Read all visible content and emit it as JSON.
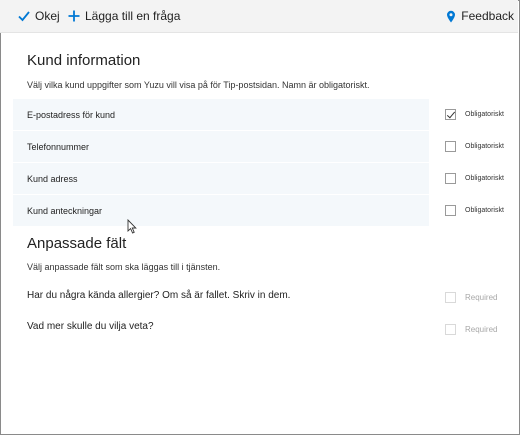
{
  "toolbar": {
    "ok_label": "Okej",
    "add_label": "Lägga till en fråga",
    "feedback_label": "Feedback"
  },
  "customer_info": {
    "title": "Kund information",
    "description": "Välj vilka kund uppgifter som Yuzu vill visa på för Tip-postsidan. Namn är obligatoriskt.",
    "fields": [
      {
        "label": "E-postadress för kund",
        "required_label": "Obligatoriskt",
        "checked": true
      },
      {
        "label": "Telefonnummer",
        "required_label": "Obligatoriskt",
        "checked": false
      },
      {
        "label": "Kund adress",
        "required_label": "Obligatoriskt",
        "checked": false
      },
      {
        "label": "Kund anteckningar",
        "required_label": "Obligatoriskt",
        "checked": false
      }
    ]
  },
  "custom_fields": {
    "title": "Anpassade fält",
    "description": "Välj anpassade fält som ska läggas till i tjänsten.",
    "questions": [
      {
        "label": "Har du några kända allergier? Om så är fallet. Skriv in dem.",
        "required_label": "Required",
        "checked": false
      },
      {
        "label": "Vad mer skulle du vilja veta?",
        "required_label": "Required",
        "checked": false
      }
    ]
  },
  "colors": {
    "accent": "#0078d4",
    "toolbar_bg": "#f3f3f3",
    "row_bg": "#f4f8fb"
  }
}
